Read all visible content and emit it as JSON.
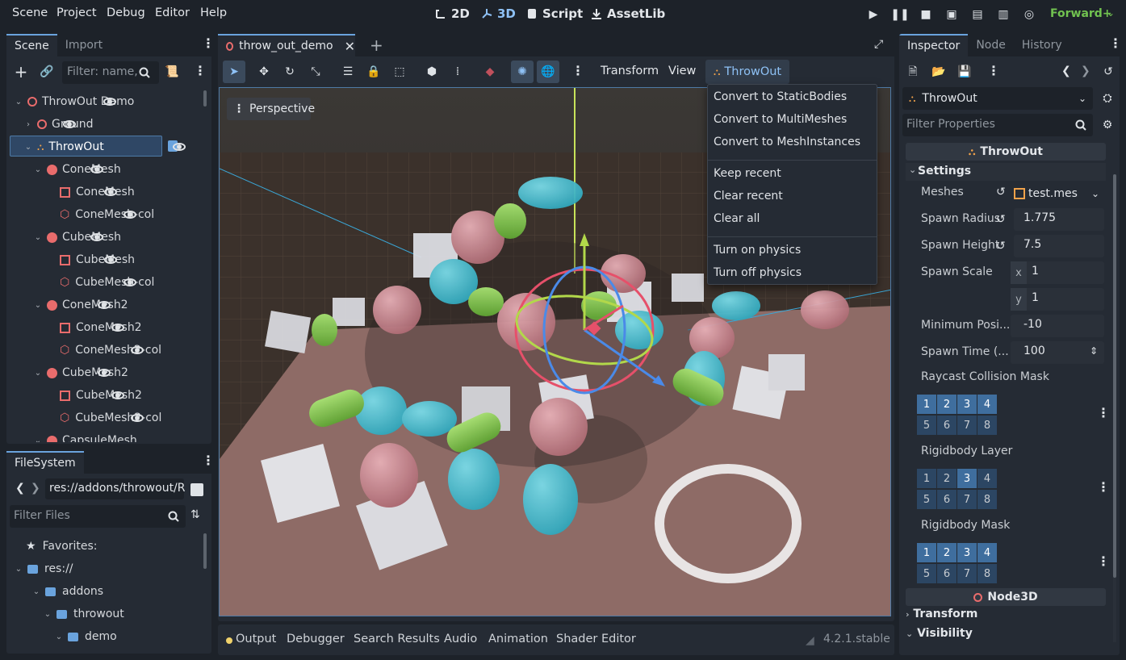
{
  "menubar": {
    "items": [
      "Scene",
      "Project",
      "Debug",
      "Editor",
      "Help"
    ],
    "workspaces": [
      "2D",
      "3D",
      "Script",
      "AssetLib"
    ],
    "renderer": "Forward+"
  },
  "scene_dock": {
    "tabs": [
      "Scene",
      "Import"
    ],
    "filter_placeholder": "Filter: name,",
    "tree": [
      {
        "label": "ThrowOut Demo",
        "icon": "node3d-icon",
        "depth": 0
      },
      {
        "label": "Ground",
        "icon": "node3d-icon",
        "depth": 1
      },
      {
        "label": "ThrowOut",
        "icon": "throwout-icon",
        "depth": 1
      },
      {
        "label": "ConeMesh",
        "icon": "rigidbody-icon",
        "depth": 2
      },
      {
        "label": "ConeMesh",
        "icon": "mesh-icon",
        "depth": 3
      },
      {
        "label": "ConeMesh-col",
        "icon": "collision-icon",
        "depth": 3
      },
      {
        "label": "CubeMesh",
        "icon": "rigidbody-icon",
        "depth": 2
      },
      {
        "label": "CubeMesh",
        "icon": "mesh-icon",
        "depth": 3
      },
      {
        "label": "CubeMesh-col",
        "icon": "collision-icon",
        "depth": 3
      },
      {
        "label": "ConeMesh2",
        "icon": "rigidbody-icon",
        "depth": 2
      },
      {
        "label": "ConeMesh2",
        "icon": "mesh-icon",
        "depth": 3
      },
      {
        "label": "ConeMesh2-col",
        "icon": "collision-icon",
        "depth": 3
      },
      {
        "label": "CubeMesh2",
        "icon": "rigidbody-icon",
        "depth": 2
      },
      {
        "label": "CubeMesh2",
        "icon": "mesh-icon",
        "depth": 3
      },
      {
        "label": "CubeMesh2-col",
        "icon": "collision-icon",
        "depth": 3
      },
      {
        "label": "CapsuleMesh",
        "icon": "rigidbody-icon",
        "depth": 2
      }
    ]
  },
  "filesystem_dock": {
    "tab": "FileSystem",
    "path": "res://addons/throwout/R",
    "filter_placeholder": "Filter Files",
    "tree": [
      {
        "label": "Favorites:",
        "depth": 0
      },
      {
        "label": "res://",
        "depth": 0
      },
      {
        "label": "addons",
        "depth": 1
      },
      {
        "label": "throwout",
        "depth": 2
      },
      {
        "label": "demo",
        "depth": 3
      }
    ]
  },
  "editor": {
    "scene_tab": "throw_out_demo",
    "toolbar_menus": [
      "Transform",
      "View"
    ],
    "plugin_menu": "ThrowOut",
    "viewport_label": "Perspective"
  },
  "dropdown": {
    "items": [
      [
        "Convert to StaticBodies",
        "Convert to MultiMeshes",
        "Convert to MeshInstances"
      ],
      [
        "Keep recent",
        "Clear recent",
        "Clear all"
      ],
      [
        "Turn on physics",
        "Turn off physics"
      ]
    ]
  },
  "bottom_panel": {
    "tabs": [
      "Output",
      "Debugger",
      "Search Results",
      "Audio",
      "Animation",
      "Shader Editor"
    ],
    "version": "4.2.1.stable"
  },
  "inspector": {
    "tabs": [
      "Inspector",
      "Node",
      "History"
    ],
    "node_name": "ThrowOut",
    "filter_placeholder": "Filter Properties",
    "category": "ThrowOut",
    "group": "Settings",
    "props": {
      "meshes": {
        "label": "Meshes",
        "value": "test.mes"
      },
      "spawn_radius": {
        "label": "Spawn Radius",
        "value": "1.775"
      },
      "spawn_height": {
        "label": "Spawn Height",
        "value": "7.5"
      },
      "spawn_scale": {
        "label": "Spawn Scale",
        "x_label": "x",
        "x": "1",
        "y_label": "y",
        "y": "1"
      },
      "min_pos": {
        "label": "Minimum Posi...",
        "value": "-10"
      },
      "spawn_time": {
        "label": "Spawn Time (...",
        "value": "100"
      }
    },
    "masks": [
      {
        "label": "Raycast Collision Mask",
        "on": [
          1,
          2,
          3,
          4
        ]
      },
      {
        "label": "Rigidbody Layer",
        "on": [
          3
        ]
      },
      {
        "label": "Rigidbody Mask",
        "on": [
          1,
          2,
          3,
          4
        ]
      }
    ],
    "category2": "Node3D",
    "sections": [
      "Transform",
      "Visibility"
    ]
  },
  "colors": {
    "accent": "#6aa3dd",
    "panel": "#252b34",
    "background": "#1d2229",
    "node": "#e96c6c",
    "physics": "#f0d26b"
  }
}
